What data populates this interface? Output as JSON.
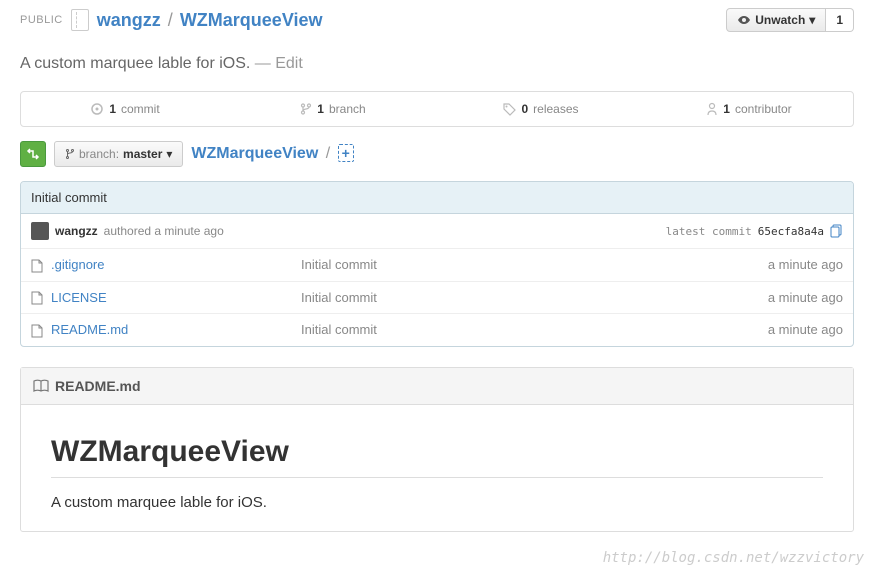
{
  "header": {
    "public_label": "PUBLIC",
    "owner": "wangzz",
    "repo": "WZMarqueeView",
    "unwatch_label": "Unwatch",
    "watch_count": "1"
  },
  "description": {
    "text": "A custom marquee lable for iOS.",
    "edit": "— Edit"
  },
  "stats": {
    "commits_n": "1",
    "commits_label": "commit",
    "branches_n": "1",
    "branches_label": "branch",
    "releases_n": "0",
    "releases_label": "releases",
    "contributors_n": "1",
    "contributors_label": "contributor"
  },
  "branch": {
    "prefix": "branch:",
    "name": "master",
    "path_repo": "WZMarqueeView"
  },
  "commit": {
    "title": "Initial commit",
    "author": "wangzz",
    "authored": "authored a minute ago",
    "latest_label": "latest commit",
    "sha": "65ecfa8a4a"
  },
  "files": [
    {
      "name": ".gitignore",
      "msg": "Initial commit",
      "time": "a minute ago"
    },
    {
      "name": "LICENSE",
      "msg": "Initial commit",
      "time": "a minute ago"
    },
    {
      "name": "README.md",
      "msg": "Initial commit",
      "time": "a minute ago"
    }
  ],
  "readme": {
    "filename": "README.md",
    "title": "WZMarqueeView",
    "body": "A custom marquee lable for iOS."
  },
  "watermark": "http://blog.csdn.net/wzzvictory"
}
